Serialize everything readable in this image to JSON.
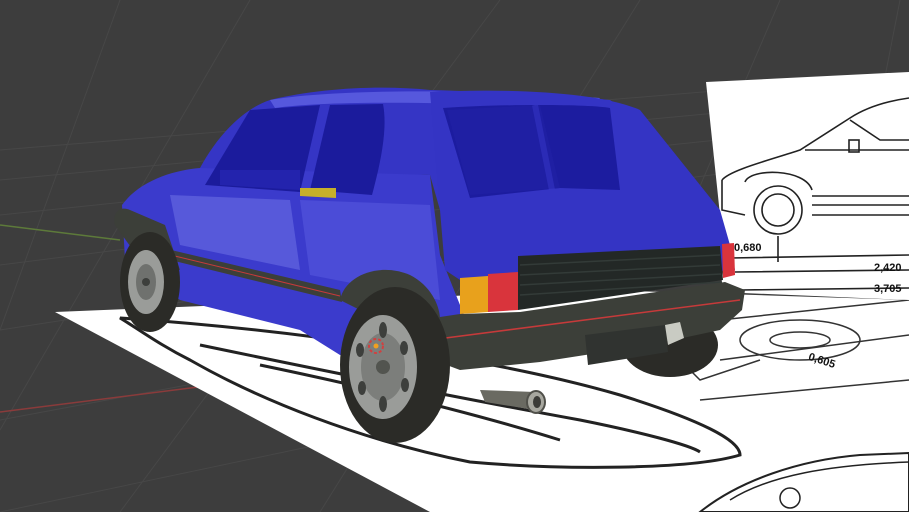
{
  "viewport": {
    "background": "#3d3d3d",
    "grid_color": "#474747",
    "x_axis_color": "#8a3b3b",
    "y_axis_color": "#5d7a3a"
  },
  "car": {
    "body_color": "#3838c8",
    "body_highlight": "#6f73e6",
    "trim_color": "#3c3f39",
    "tire_color": "#2b2b27",
    "rim_color": "#9a9c99",
    "taillight_amber": "#e8a11c",
    "taillight_red": "#d9343c",
    "pinstripe_color": "#c63a3a"
  },
  "blueprint": {
    "dimensions": {
      "d1": "0,680",
      "d2": "2,420",
      "d3": "3,705",
      "d4": "0,605"
    }
  }
}
